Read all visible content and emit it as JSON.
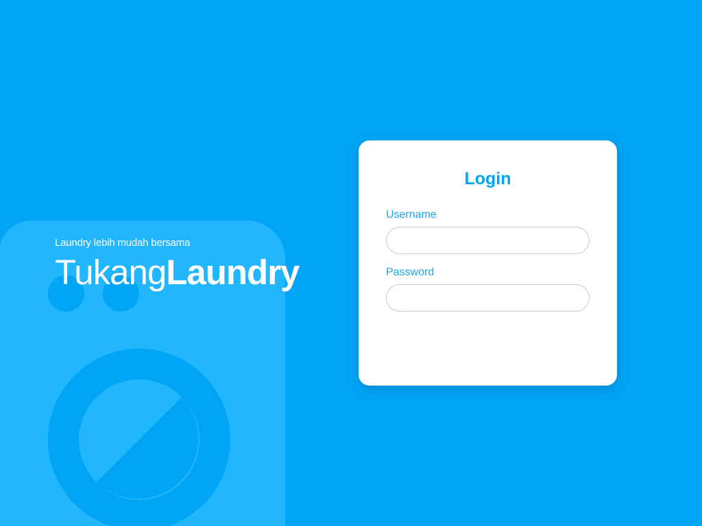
{
  "brand": {
    "tagline": "Laundry lebih mudah bersama",
    "name_light": "Tukang",
    "name_bold": "Laundry"
  },
  "login": {
    "title": "Login",
    "username_label": "Username",
    "username_value": "",
    "password_label": "Password",
    "password_value": ""
  },
  "colors": {
    "background": "#00a5f6",
    "washer_illustration": "#22b6ff",
    "card": "#ffffff",
    "accent": "#00a5f6",
    "input_border": "#c9c9c9"
  },
  "icons": {
    "illustration": "washing-machine-illustration"
  }
}
